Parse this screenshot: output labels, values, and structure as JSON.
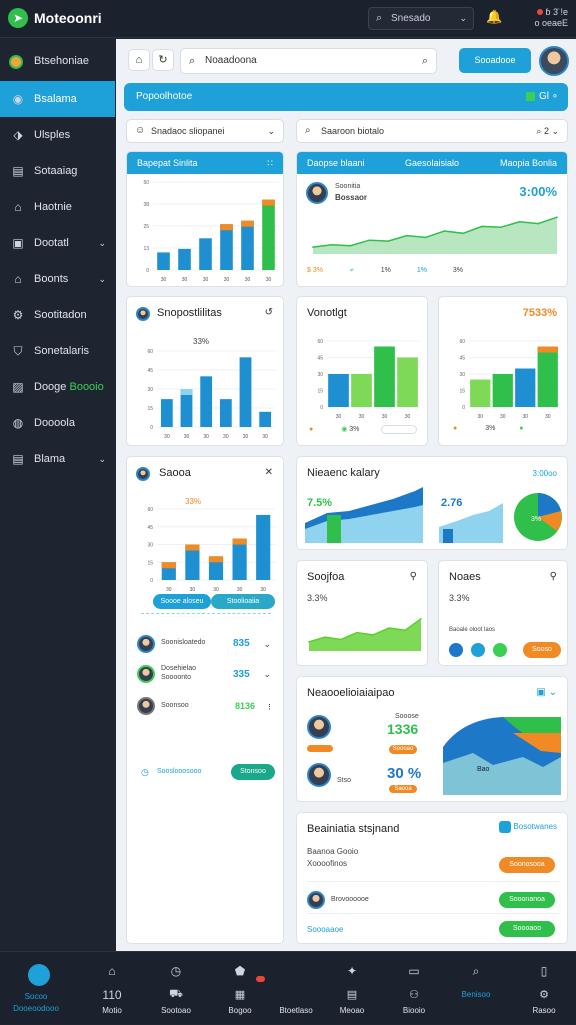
{
  "app": {
    "title": "Moteoonri"
  },
  "topbar": {
    "search_label": "Snesado",
    "status": "ɓ 3̈ !e",
    "status_sub": "o oeaeE"
  },
  "sidebar": {
    "items": [
      {
        "label": "Btsehoniae"
      },
      {
        "label": "Bsalama"
      },
      {
        "label": "Ulsples"
      },
      {
        "label": "Sotaaiag"
      },
      {
        "label": "Haotnie"
      },
      {
        "label": "Dootatl"
      },
      {
        "label": "Boonts"
      },
      {
        "label": "Sootitadon"
      },
      {
        "label": "Sonetalaris"
      },
      {
        "label": "Dooge",
        "extra": "Boooio"
      },
      {
        "label": "Doooola"
      },
      {
        "label": "Blama"
      }
    ]
  },
  "header": {
    "search_placeholder": "Noaadoona",
    "cta": "Sooadooe"
  },
  "banner": {
    "title": "Popoolhotoe",
    "right_text": "Gl ∘"
  },
  "filters": [
    {
      "label": "Snadaoc sliopanei"
    },
    {
      "label": "Saaroon biotalo",
      "right": "2"
    }
  ],
  "cards": {
    "c1": {
      "head_left": "Bapepat Sinlita",
      "head_right": "∷"
    },
    "c2": {
      "head_left": "Daopse blaani",
      "head_mid": "Gaesolaisialo",
      "head_right": "Maopia Bonlia",
      "user_name": "Soonitia",
      "user_sub": "Bossaor",
      "value": "3:00%",
      "footer": [
        "$ 3%",
        "≁",
        "1%",
        "1%",
        "3%"
      ]
    },
    "c3": {
      "title": "Snopostlilitas",
      "pct": "33%"
    },
    "c4": {
      "title": "Vonotlgt",
      "foot": "3%"
    },
    "c5": {
      "title": "",
      "value": "7533%",
      "foot": "3%"
    },
    "c6": {
      "title": "Saooa",
      "pct": "33%",
      "pill_left": "Soooe aloseu",
      "pill_right": "Stoolioaiia",
      "rows": [
        {
          "name": "Soonisloatedo",
          "value": "835"
        },
        {
          "name": "Dosehielao",
          "name2": "Soooonto",
          "value": "335"
        },
        {
          "name": "Soonsoo",
          "value": "8136"
        }
      ],
      "footer_link": "Sooslooosooo",
      "footer_btn": "Stonsoo"
    },
    "c7": {
      "title": "Nieaenc kalary",
      "right": "3:00oo",
      "v1": "7.5%",
      "v2": "2.76",
      "pie_label": "3%"
    },
    "c8": {
      "title": "Soojfoa",
      "value": "3.3%"
    },
    "c9": {
      "title": "Noaes",
      "value": "3.3%",
      "btn": "Sooso",
      "tiny": "Baoale oloot laos"
    },
    "c10": {
      "title": "Neaooelioiaiaipao",
      "v1": "1336",
      "v2": "30 %",
      "v1_top": "Sooose",
      "v1_btn": "Soooao",
      "v2_top": "Stso",
      "v2_btn": "Saooa",
      "lbl": "Bao"
    },
    "c11": {
      "title": "Beainiatia stsjnand",
      "chip": "Bosotwanes",
      "sub1": "Baanoa Gooio",
      "sub2": "Xoooofinos",
      "btn1": "Soonosooa",
      "row_name": "Brovoooooe",
      "btn2": "Sooonanoa",
      "link": "Soooaaoe",
      "btn3": "Soooaoo"
    }
  },
  "bottombar": [
    {
      "label": "Socoo",
      "sub": "Dooeoodooo"
    },
    {
      "label": "110",
      "sub": "Motio"
    },
    {
      "label": "",
      "sub": "Sootoao"
    },
    {
      "label": "",
      "sub": "Bogoo"
    },
    {
      "label": "",
      "sub": "Btoetlaso"
    },
    {
      "label": "",
      "sub": "Meoao"
    },
    {
      "label": "",
      "sub": "Biooio"
    },
    {
      "label": "",
      "sub": "Benisoo"
    },
    {
      "label": "",
      "sub": "Rasoo"
    }
  ],
  "chart_data": [
    {
      "type": "bar",
      "id": "c1",
      "categories": [
        "30",
        "30",
        "30",
        "30",
        "30",
        "30"
      ],
      "series": [
        {
          "name": "",
          "values": [
            10,
            12,
            18,
            26,
            28,
            40
          ]
        }
      ],
      "ylim": [
        0,
        50
      ]
    },
    {
      "type": "area",
      "id": "c2",
      "values": [
        15,
        20,
        18,
        30,
        28,
        40,
        36,
        50,
        45,
        60,
        58,
        70,
        66,
        80
      ],
      "ylim": [
        0,
        100
      ]
    },
    {
      "type": "bar",
      "id": "c3",
      "categories": [
        "30",
        "30",
        "30",
        "30",
        "30",
        "30"
      ],
      "values": [
        22,
        30,
        40,
        22,
        55,
        12
      ],
      "ylim": [
        0,
        60
      ]
    },
    {
      "type": "bar",
      "id": "c4",
      "categories": [
        "30",
        "30",
        "30",
        "30"
      ],
      "values": [
        30,
        30,
        55,
        45
      ],
      "ylim": [
        0,
        60
      ]
    },
    {
      "type": "bar",
      "id": "c5",
      "categories": [
        "30",
        "30",
        "30",
        "30"
      ],
      "values": [
        25,
        30,
        35,
        55
      ],
      "ylim": [
        0,
        60
      ]
    },
    {
      "type": "bar",
      "id": "c6",
      "categories": [
        "30",
        "30",
        "30",
        "30",
        "30"
      ],
      "values": [
        15,
        30,
        20,
        35,
        55
      ],
      "ylim": [
        0,
        60
      ]
    },
    {
      "type": "area",
      "id": "c8",
      "values": [
        20,
        30,
        25,
        40,
        35,
        50,
        45,
        70
      ],
      "ylim": [
        0,
        100
      ]
    }
  ]
}
